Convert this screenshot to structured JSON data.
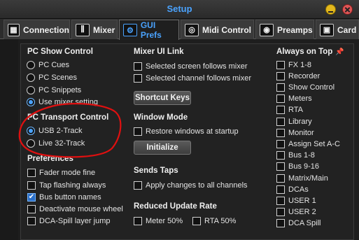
{
  "window": {
    "title": "Setup"
  },
  "tabs": [
    {
      "label": "Connection",
      "icon": "connection-icon",
      "glyph": "▦"
    },
    {
      "label": "Mixer",
      "icon": "mixer-icon",
      "glyph": "⫼"
    },
    {
      "label": "GUI Prefs",
      "icon": "gear-icon",
      "glyph": "⚙"
    },
    {
      "label": "Midi Control",
      "icon": "midi-icon",
      "glyph": "◎"
    },
    {
      "label": "Preamps",
      "icon": "preamp-icon",
      "glyph": "◉"
    },
    {
      "label": "Card",
      "icon": "card-icon",
      "glyph": "▣"
    }
  ],
  "active_tab": "GUI Prefs",
  "pc_show_control": {
    "title": "PC Show Control",
    "options": [
      "PC Cues",
      "PC Scenes",
      "PC Snippets",
      "Use mixer setting"
    ],
    "selected": "Use mixer setting"
  },
  "pc_transport_control": {
    "title": "PC Transport Control",
    "options": [
      "USB 2-Track",
      "Live 32-Track"
    ],
    "selected": "USB 2-Track"
  },
  "preferences": {
    "title": "Preferences",
    "items": [
      {
        "label": "Fader mode fine",
        "checked": false
      },
      {
        "label": "Tap flashing always",
        "checked": false
      },
      {
        "label": "Bus button names",
        "checked": true
      },
      {
        "label": "Deactivate mouse wheel",
        "checked": false
      },
      {
        "label": "DCA-Spill layer jump",
        "checked": false
      }
    ]
  },
  "mixer_ui_link": {
    "title": "Mixer UI Link",
    "items": [
      {
        "label": "Selected screen follows mixer",
        "checked": false
      },
      {
        "label": "Selected channel follows mixer",
        "checked": false
      }
    ],
    "shortcut_button": "Shortcut Keys"
  },
  "window_mode": {
    "title": "Window Mode",
    "items": [
      {
        "label": "Restore windows at startup",
        "checked": false
      }
    ],
    "initialize_button": "Initialize"
  },
  "sends_taps": {
    "title": "Sends Taps",
    "items": [
      {
        "label": "Apply changes to all channels",
        "checked": false
      }
    ]
  },
  "reduced_update_rate": {
    "title": "Reduced Update Rate",
    "items": [
      {
        "label": "Meter 50%",
        "checked": false
      },
      {
        "label": "RTA 50%",
        "checked": false
      }
    ]
  },
  "always_on_top": {
    "title": "Always on Top",
    "pin_icon": "pin-icon",
    "items": [
      {
        "label": "FX 1-8",
        "checked": false
      },
      {
        "label": "Recorder",
        "checked": false
      },
      {
        "label": "Show Control",
        "checked": false
      },
      {
        "label": "Meters",
        "checked": false
      },
      {
        "label": "RTA",
        "checked": false
      },
      {
        "label": "Library",
        "checked": false
      },
      {
        "label": "Monitor",
        "checked": false
      },
      {
        "label": "Assign Set A-C",
        "checked": false
      },
      {
        "label": "Bus 1-8",
        "checked": false
      },
      {
        "label": "Bus 9-16",
        "checked": false
      },
      {
        "label": "Matrix/Main",
        "checked": false
      },
      {
        "label": "DCAs",
        "checked": false
      },
      {
        "label": "USER 1",
        "checked": false
      },
      {
        "label": "USER 2",
        "checked": false
      },
      {
        "label": "DCA Spill",
        "checked": false
      }
    ]
  },
  "colors": {
    "accent": "#4aa3ff",
    "annotation": "#e01010",
    "background": "#1e1e1e"
  }
}
